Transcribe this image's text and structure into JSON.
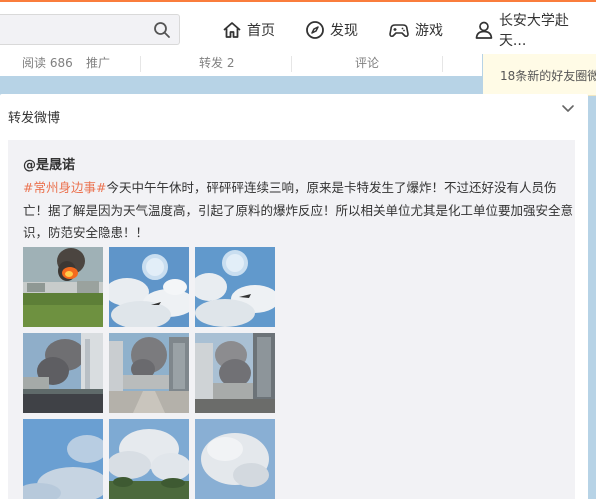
{
  "nav": {
    "home": "首页",
    "discover": "发现",
    "games": "游戏",
    "user": "长安大学赴天..."
  },
  "search": {
    "placeholder": ""
  },
  "prev_actions": {
    "reads": "阅读 686",
    "promote": "推广",
    "repost": "转发 2",
    "comment": "评论"
  },
  "notice": {
    "text": "18条新的好友圈微"
  },
  "card": {
    "repost_label": "转发微博",
    "author": "@是晟诺",
    "topic": "#常州身边事#",
    "text": "今天中午午休时，砰砰砰连续三响，原来是卡特发生了爆炸！不过还好没有人员伤亡！据了解是因为天气温度高，引起了原料的爆炸反应！所以相关单位尤其是化工单位要加强安全意识，防范安全隐患！！"
  },
  "images": [
    {
      "name": "explosion-field-photo"
    },
    {
      "name": "sky-sun-photo-1"
    },
    {
      "name": "sky-sun-photo-2"
    },
    {
      "name": "smoke-building-photo-1"
    },
    {
      "name": "smoke-street-photo"
    },
    {
      "name": "smoke-building-photo-2"
    },
    {
      "name": "blue-sky-photo"
    },
    {
      "name": "cloud-sky-photo-1"
    },
    {
      "name": "cloud-sky-photo-2"
    }
  ],
  "colors": {
    "accent": "#fa7d3c",
    "topic": "#eb7350",
    "background": "#b7d3e6"
  }
}
